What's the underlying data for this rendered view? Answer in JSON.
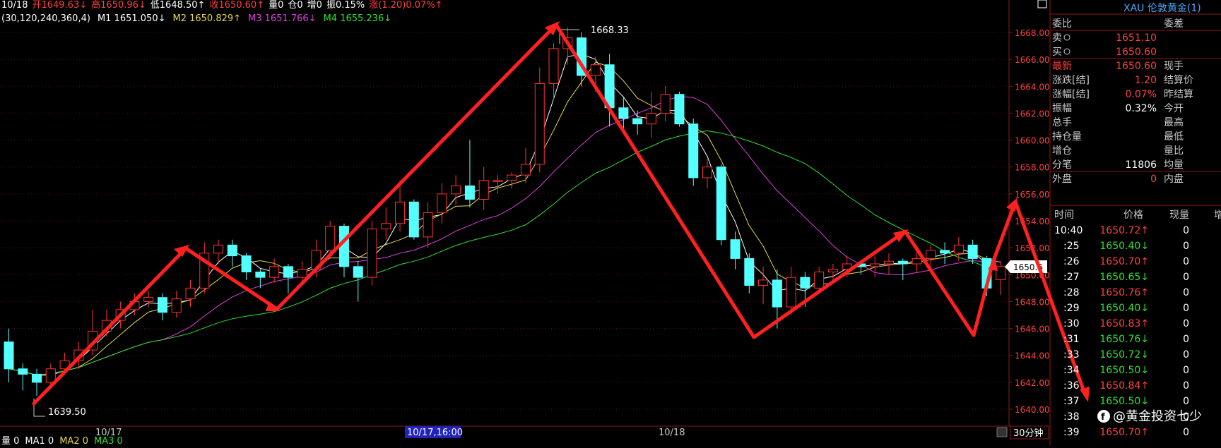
{
  "infobar": {
    "items": [
      {
        "text": "10/18",
        "color": "#ffffff"
      },
      {
        "text": "开1649.63↓",
        "color": "#ff4040"
      },
      {
        "text": "高1650.96↓",
        "color": "#ff4040"
      },
      {
        "text": "低1648.50↑",
        "color": "#ffffff"
      },
      {
        "text": "收1650.60↑",
        "color": "#ff4040"
      },
      {
        "text": "量0",
        "color": "#ffffff"
      },
      {
        "text": "仓0",
        "color": "#ffffff"
      },
      {
        "text": "增0",
        "color": "#ffffff"
      },
      {
        "text": "振0.15%",
        "color": "#ffffff"
      },
      {
        "text": "涨(1.20)0.07%↑",
        "color": "#ff4040"
      }
    ],
    "ma_params": "(30,120,240,360,4)",
    "ma": [
      {
        "text": "M1 1651.050↓",
        "color": "#ffffff"
      },
      {
        "text": "M2 1650.829↑",
        "color": "#e8d84a"
      },
      {
        "text": "M3 1651.766↓",
        "color": "#e040e0"
      },
      {
        "text": "M4 1655.236↓",
        "color": "#30e030"
      }
    ],
    "bottom_labels": [
      {
        "text": "量 0",
        "color": "#ffffff"
      },
      {
        "text": "MA1 0",
        "color": "#ffffff"
      },
      {
        "text": "MA2 0",
        "color": "#e8d84a"
      },
      {
        "text": "MA3 0",
        "color": "#30e030"
      }
    ]
  },
  "chart_data": {
    "type": "candlestick",
    "period": "30分钟",
    "y_axis": {
      "min": 1640.0,
      "max": 1668.0,
      "step": 2,
      "ticks": [
        "1668.00",
        "1666.00",
        "1664.00",
        "1662.00",
        "1660.00",
        "1658.00",
        "1656.00",
        "1654.00",
        "1652.00",
        "1650.00",
        "1648.00",
        "1646.00",
        "1644.00",
        "1642.00",
        "1640.00"
      ]
    },
    "x_labels": [
      {
        "text": "10/17",
        "highlight": false
      },
      {
        "text": "10/17,16:00",
        "highlight": true
      },
      {
        "text": "10/18",
        "highlight": false
      }
    ],
    "current_price_label": "1650.6",
    "high_annotation": "1668.33",
    "low_annotation": "1639.50",
    "up_color": "#ff3232",
    "down_color": "#54ffff",
    "candles": [
      [
        1645.0,
        1643.0,
        1646.0,
        1642.0
      ],
      [
        1643.0,
        1642.6,
        1643.4,
        1641.4
      ],
      [
        1642.6,
        1642.0,
        1643.0,
        1641.0
      ],
      [
        1642.0,
        1643.0,
        1643.4,
        1641.6
      ],
      [
        1643.0,
        1643.6,
        1644.2,
        1642.6
      ],
      [
        1643.6,
        1644.4,
        1645.0,
        1643.0
      ],
      [
        1644.4,
        1645.8,
        1647.4,
        1644.0
      ],
      [
        1645.8,
        1646.6,
        1647.4,
        1645.4
      ],
      [
        1646.6,
        1647.4,
        1648.0,
        1646.0
      ],
      [
        1647.4,
        1648.0,
        1648.6,
        1647.0
      ],
      [
        1648.0,
        1648.3,
        1648.8,
        1647.6
      ],
      [
        1648.3,
        1647.2,
        1648.6,
        1646.6
      ],
      [
        1647.2,
        1648.2,
        1648.8,
        1646.8
      ],
      [
        1648.2,
        1649.0,
        1649.6,
        1647.6
      ],
      [
        1649.0,
        1651.6,
        1652.4,
        1648.6
      ],
      [
        1651.6,
        1652.2,
        1652.6,
        1650.8
      ],
      [
        1652.2,
        1651.4,
        1652.6,
        1650.6
      ],
      [
        1651.4,
        1650.2,
        1651.6,
        1649.6
      ],
      [
        1650.2,
        1649.8,
        1650.4,
        1649.0
      ],
      [
        1649.8,
        1650.6,
        1651.2,
        1649.4
      ],
      [
        1650.6,
        1649.8,
        1650.8,
        1648.6
      ],
      [
        1649.8,
        1650.4,
        1651.0,
        1649.2
      ],
      [
        1650.4,
        1651.8,
        1652.6,
        1649.8
      ],
      [
        1651.8,
        1653.6,
        1654.0,
        1651.2
      ],
      [
        1653.6,
        1650.6,
        1653.8,
        1649.8
      ],
      [
        1650.6,
        1649.8,
        1651.0,
        1648.0
      ],
      [
        1649.8,
        1653.4,
        1654.0,
        1649.2
      ],
      [
        1653.4,
        1653.8,
        1655.0,
        1652.6
      ],
      [
        1653.8,
        1655.4,
        1657.0,
        1653.2
      ],
      [
        1655.4,
        1652.8,
        1655.6,
        1652.6
      ],
      [
        1652.8,
        1654.6,
        1655.4,
        1652.0
      ],
      [
        1654.6,
        1656.0,
        1656.8,
        1653.8
      ],
      [
        1656.0,
        1656.6,
        1657.4,
        1655.2
      ],
      [
        1656.6,
        1655.6,
        1660.0,
        1655.0
      ],
      [
        1655.6,
        1657.0,
        1658.0,
        1654.8
      ],
      [
        1657.0,
        1657.0,
        1657.4,
        1656.0
      ],
      [
        1657.0,
        1657.4,
        1657.6,
        1656.4
      ],
      [
        1657.4,
        1658.2,
        1659.4,
        1656.8
      ],
      [
        1658.2,
        1664.2,
        1665.4,
        1657.6
      ],
      [
        1664.2,
        1666.8,
        1667.2,
        1663.0
      ],
      [
        1666.8,
        1667.6,
        1668.4,
        1665.6
      ],
      [
        1667.6,
        1664.8,
        1668.0,
        1664.0
      ],
      [
        1664.8,
        1665.6,
        1666.2,
        1663.6
      ],
      [
        1665.6,
        1662.4,
        1666.4,
        1661.0
      ],
      [
        1662.4,
        1661.6,
        1663.2,
        1660.8
      ],
      [
        1661.6,
        1661.2,
        1662.2,
        1660.4
      ],
      [
        1661.2,
        1662.0,
        1663.6,
        1660.2
      ],
      [
        1662.0,
        1663.4,
        1664.0,
        1661.4
      ],
      [
        1663.4,
        1661.2,
        1663.6,
        1661.0
      ],
      [
        1661.2,
        1657.2,
        1661.6,
        1656.6
      ],
      [
        1657.2,
        1658.0,
        1658.6,
        1656.4
      ],
      [
        1658.0,
        1652.6,
        1658.2,
        1652.2
      ],
      [
        1652.6,
        1651.2,
        1653.2,
        1650.4
      ],
      [
        1651.2,
        1649.2,
        1651.6,
        1648.6
      ],
      [
        1649.2,
        1649.6,
        1650.6,
        1647.8
      ],
      [
        1649.6,
        1647.6,
        1650.4,
        1646.0
      ],
      [
        1647.6,
        1649.8,
        1650.6,
        1647.0
      ],
      [
        1649.8,
        1649.0,
        1650.2,
        1647.6
      ],
      [
        1649.0,
        1650.2,
        1650.6,
        1648.8
      ],
      [
        1650.2,
        1650.4,
        1650.8,
        1649.6
      ],
      [
        1650.4,
        1650.8,
        1651.4,
        1649.8
      ],
      [
        1650.8,
        1650.6,
        1651.0,
        1650.0
      ],
      [
        1650.6,
        1650.8,
        1651.4,
        1649.8
      ],
      [
        1650.8,
        1651.0,
        1651.6,
        1650.0
      ],
      [
        1651.0,
        1650.8,
        1651.2,
        1649.6
      ],
      [
        1650.8,
        1651.2,
        1651.8,
        1650.2
      ],
      [
        1651.2,
        1651.8,
        1652.2,
        1650.6
      ],
      [
        1651.8,
        1651.6,
        1652.4,
        1650.8
      ],
      [
        1651.6,
        1652.2,
        1652.8,
        1651.0
      ],
      [
        1652.2,
        1651.2,
        1652.6,
        1650.8
      ],
      [
        1651.2,
        1649.0,
        1651.4,
        1648.4
      ],
      [
        1649.63,
        1650.6,
        1650.96,
        1648.5
      ]
    ]
  },
  "quote_panel": {
    "header_symbol": "XAU 伦敦黄金(1)",
    "rows": [
      {
        "l1": "委比",
        "v": "",
        "l2": "委差",
        "lc": "#c8c8c8",
        "vc": "#c8c8c8"
      },
      {
        "l1": "卖",
        "v": "1651.10",
        "l2": "",
        "lc": "#c8c8c8",
        "vc": "#ff4040"
      },
      {
        "l1": "买",
        "v": "1650.60",
        "l2": "",
        "lc": "#c8c8c8",
        "vc": "#ff4040"
      },
      {
        "l1": "最新",
        "v": "1650.60",
        "l2": "现手",
        "lc": "#ff4040",
        "vc": "#ff4040"
      },
      {
        "l1": "涨跌[结]",
        "v": "1.20",
        "l2": "结算价",
        "lc": "#c8c8c8",
        "vc": "#ff4040"
      },
      {
        "l1": "涨幅[结]",
        "v": "0.07%",
        "l2": "昨结算",
        "lc": "#c8c8c8",
        "vc": "#ff4040"
      },
      {
        "l1": "振幅",
        "v": "0.32%",
        "l2": "今开",
        "lc": "#c8c8c8",
        "vc": "#ffffff"
      },
      {
        "l1": "总手",
        "v": "",
        "l2": "最高",
        "lc": "#c8c8c8",
        "vc": "#ffffff"
      },
      {
        "l1": "持仓量",
        "v": "",
        "l2": "最低",
        "lc": "#c8c8c8",
        "vc": "#ffffff"
      },
      {
        "l1": "增仓",
        "v": "",
        "l2": "量比",
        "lc": "#c8c8c8",
        "vc": "#ffffff"
      },
      {
        "l1": "分笔",
        "v": "11806",
        "l2": "均量",
        "lc": "#c8c8c8",
        "vc": "#ffffff"
      },
      {
        "l1": "外盘",
        "v": "0",
        "l2": "内盘",
        "lc": "#c8c8c8",
        "vc": "#ff4040"
      }
    ],
    "tick_header": {
      "time": "时间",
      "price": "价格",
      "vol": "现量",
      "chg": "增"
    },
    "ticks": [
      {
        "time": "10:40",
        "price": "1650.72↑",
        "vol": "0",
        "pc": "#ff4040"
      },
      {
        "time": ":25",
        "price": "1650.40↓",
        "vol": "0",
        "pc": "#30e030"
      },
      {
        "time": ":26",
        "price": "1650.70↑",
        "vol": "0",
        "pc": "#ff4040"
      },
      {
        "time": ":27",
        "price": "1650.65↓",
        "vol": "0",
        "pc": "#30e030"
      },
      {
        "time": ":28",
        "price": "1650.76↑",
        "vol": "0",
        "pc": "#ff4040"
      },
      {
        "time": ":29",
        "price": "1650.40↓",
        "vol": "0",
        "pc": "#30e030"
      },
      {
        "time": ":30",
        "price": "1650.83↑",
        "vol": "0",
        "pc": "#ff4040"
      },
      {
        "time": ":31",
        "price": "1650.76↓",
        "vol": "0",
        "pc": "#30e030"
      },
      {
        "time": ":33",
        "price": "1650.72↓",
        "vol": "0",
        "pc": "#30e030"
      },
      {
        "time": ":34",
        "price": "1650.50↓",
        "vol": "0",
        "pc": "#30e030"
      },
      {
        "time": ":36",
        "price": "1650.84↑",
        "vol": "0",
        "pc": "#ff4040"
      },
      {
        "time": ":37",
        "price": "1650.50↓",
        "vol": "0",
        "pc": "#30e030"
      },
      {
        "time": ":38",
        "price": "",
        "vol": "0",
        "pc": "#ff4040"
      },
      {
        "time": ":39",
        "price": "1650.70↑",
        "vol": "0",
        "pc": "#ff4040"
      }
    ]
  },
  "watermark": "@黄金投资七少",
  "watermark_icon": "facebook-icon",
  "colors": {
    "grid": "#5a1010",
    "axis": "#8b1a1a",
    "arrow": "#ff2020",
    "panel_label": "#c8c8c8"
  }
}
